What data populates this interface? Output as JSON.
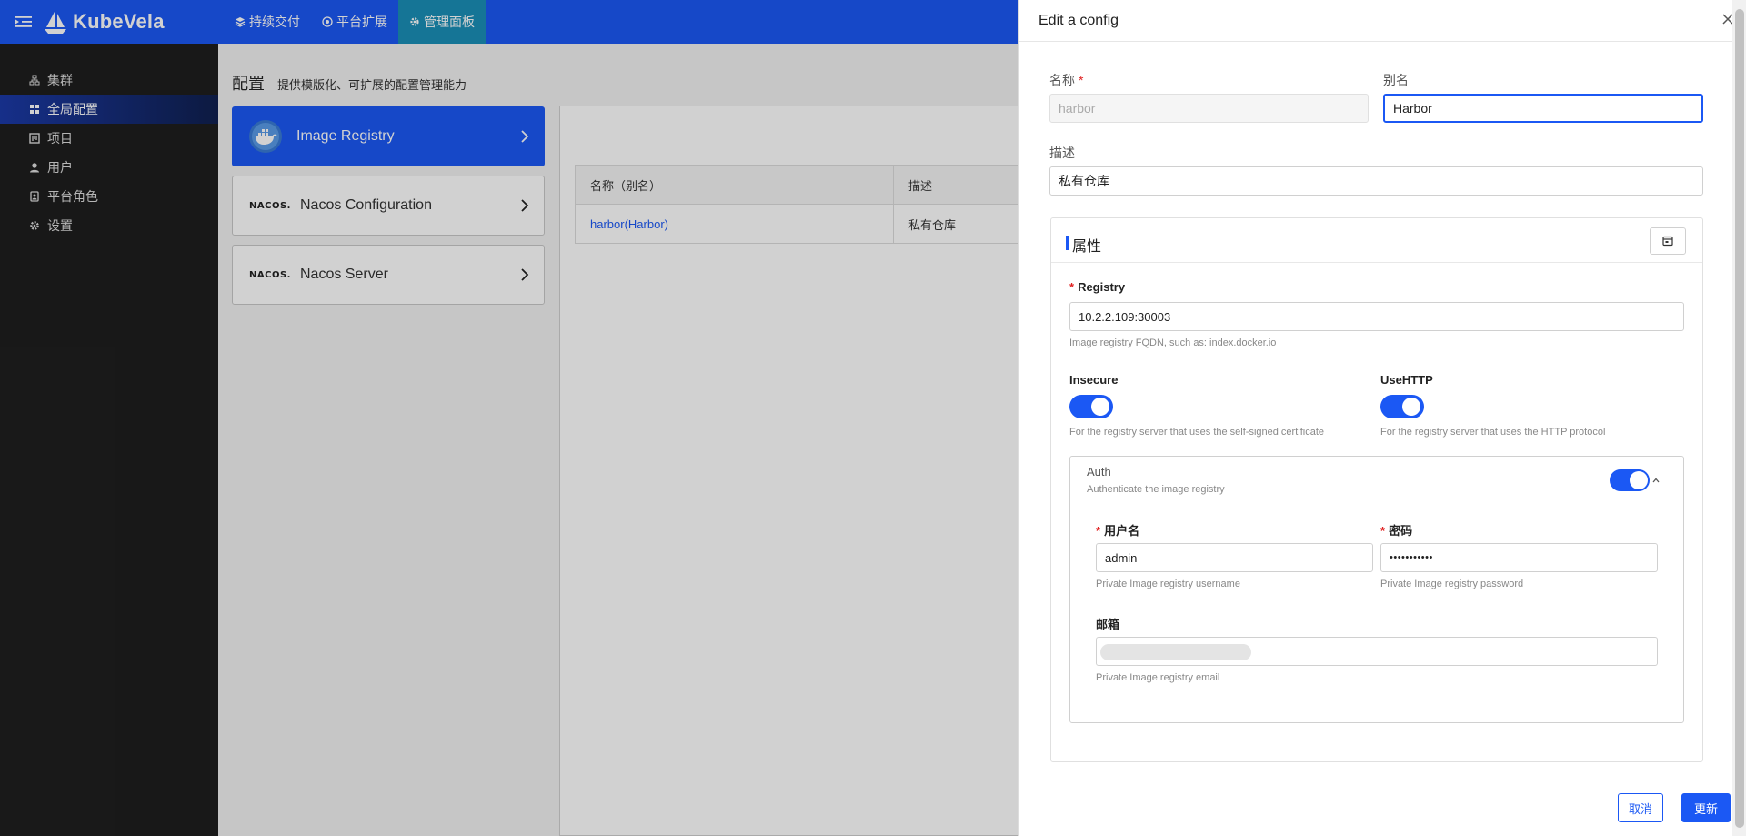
{
  "app": {
    "name": "KubeVela"
  },
  "topnav": [
    {
      "label": "持续交付",
      "icon": "layers-icon"
    },
    {
      "label": "平台扩展",
      "icon": "extension-icon"
    },
    {
      "label": "管理面板",
      "icon": "gear-icon"
    }
  ],
  "sidebar": {
    "items": [
      {
        "label": "集群",
        "icon": "cluster-icon"
      },
      {
        "label": "全局配置",
        "icon": "config-icon"
      },
      {
        "label": "项目",
        "icon": "project-icon"
      },
      {
        "label": "用户",
        "icon": "user-icon"
      },
      {
        "label": "平台角色",
        "icon": "role-icon"
      },
      {
        "label": "设置",
        "icon": "settings-icon"
      }
    ]
  },
  "page": {
    "title": "配置",
    "subtitle": "提供模版化、可扩展的配置管理能力",
    "cards": [
      {
        "label": "Image Registry",
        "logo": "docker-icon"
      },
      {
        "label": "Nacos Configuration",
        "logo": "NACOS."
      },
      {
        "label": "Nacos Server",
        "logo": "NACOS."
      }
    ],
    "table": {
      "headers": [
        "名称（别名）",
        "描述"
      ],
      "rows": [
        [
          "harbor(Harbor)",
          "私有仓库"
        ]
      ]
    }
  },
  "drawer": {
    "title": "Edit a config",
    "name_label": "名称",
    "name_value": "harbor",
    "alias_label": "别名",
    "alias_value": "Harbor",
    "desc_label": "描述",
    "desc_value": "私有仓库",
    "props_title": "属性",
    "registry": {
      "label": "Registry",
      "value": "10.2.2.109:30003",
      "help": "Image registry FQDN, such as: index.docker.io"
    },
    "insecure": {
      "label": "Insecure",
      "on": true,
      "help": "For the registry server that uses the self-signed certificate"
    },
    "usehttp": {
      "label": "UseHTTP",
      "on": true,
      "help": "For the registry server that uses the HTTP protocol"
    },
    "auth": {
      "title": "Auth",
      "subtitle": "Authenticate the image registry",
      "on": true,
      "username_label": "用户名",
      "username_value": "admin",
      "username_help": "Private Image registry username",
      "password_label": "密码",
      "password_value": "•••••••••••",
      "password_help": "Private Image registry password",
      "email_label": "邮箱",
      "email_help": "Private Image registry email"
    },
    "cancel_label": "取消",
    "submit_label": "更新"
  },
  "colors": {
    "primary": "#1b58f4",
    "sidebar_bg": "#1e1e1e",
    "active_tab": "#1a8fb8"
  }
}
